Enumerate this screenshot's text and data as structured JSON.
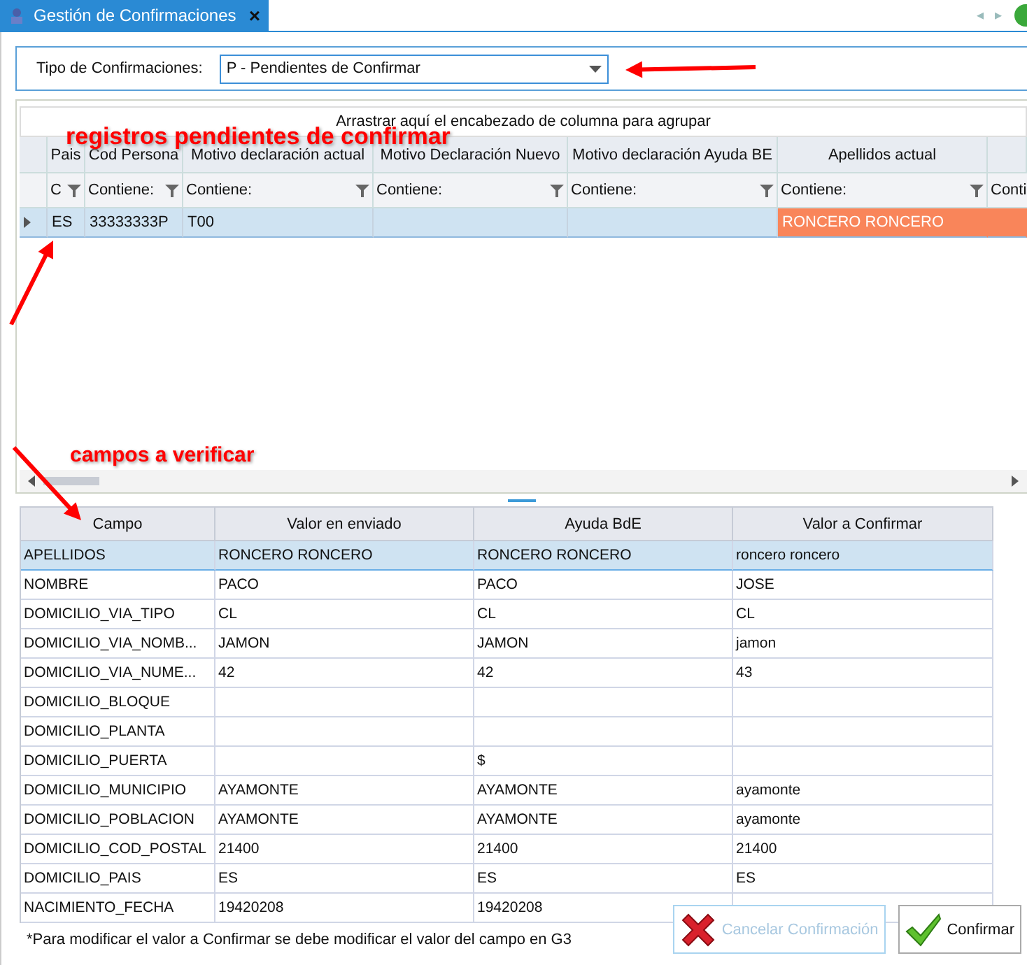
{
  "window": {
    "title": "Gestión de Confirmaciones",
    "close": "×",
    "nav_prev": "◂",
    "nav_next": "▸"
  },
  "filter": {
    "label": "Tipo de Confirmaciones:",
    "value": "P - Pendientes de Confirmar"
  },
  "records_grid": {
    "group_hint": "Arrastrar aquí el encabezado de columna para agrupar",
    "columns": [
      {
        "header": "Pais",
        "filter": "C"
      },
      {
        "header": "Cod Persona",
        "filter": "Contiene:"
      },
      {
        "header": "Motivo declaración actual",
        "filter": "Contiene:"
      },
      {
        "header": "Motivo Declaración Nuevo",
        "filter": "Contiene:"
      },
      {
        "header": "Motivo declaración Ayuda BE",
        "filter": "Contiene:"
      },
      {
        "header": "Apellidos actual",
        "filter": "Contiene:"
      },
      {
        "filter": "Conti"
      }
    ],
    "rows": [
      {
        "selected": true,
        "cells": [
          {
            "text": "ES",
            "highlighted": false
          },
          {
            "text": "33333333P",
            "highlighted": false
          },
          {
            "text": "T00",
            "highlighted": false
          },
          {
            "text": "",
            "highlighted": false
          },
          {
            "text": "",
            "highlighted": false
          },
          {
            "text": "RONCERO RONCERO",
            "highlighted": true
          },
          {
            "text": "",
            "highlighted": true
          }
        ]
      }
    ]
  },
  "fields_grid": {
    "columns": [
      "Campo",
      "Valor en enviado",
      "Ayuda BdE",
      "Valor a Confirmar"
    ],
    "rows": [
      {
        "selected": true,
        "cells": [
          "APELLIDOS",
          "RONCERO RONCERO",
          "RONCERO RONCERO",
          "roncero roncero"
        ]
      },
      {
        "selected": false,
        "cells": [
          "NOMBRE",
          "PACO",
          "PACO",
          "JOSE"
        ]
      },
      {
        "selected": false,
        "cells": [
          "DOMICILIO_VIA_TIPO",
          "CL",
          "CL",
          "CL"
        ]
      },
      {
        "selected": false,
        "cells": [
          "DOMICILIO_VIA_NOMB...",
          "JAMON",
          "JAMON",
          "jamon"
        ]
      },
      {
        "selected": false,
        "cells": [
          "DOMICILIO_VIA_NUME...",
          "42",
          "42",
          "43"
        ]
      },
      {
        "selected": false,
        "cells": [
          "DOMICILIO_BLOQUE",
          "",
          "",
          ""
        ]
      },
      {
        "selected": false,
        "cells": [
          "DOMICILIO_PLANTA",
          "",
          "",
          ""
        ]
      },
      {
        "selected": false,
        "cells": [
          "DOMICILIO_PUERTA",
          "",
          "$",
          ""
        ]
      },
      {
        "selected": false,
        "cells": [
          "DOMICILIO_MUNICIPIO",
          "AYAMONTE",
          "AYAMONTE",
          "ayamonte"
        ]
      },
      {
        "selected": false,
        "cells": [
          "DOMICILIO_POBLACION",
          "AYAMONTE",
          "AYAMONTE",
          "ayamonte"
        ]
      },
      {
        "selected": false,
        "cells": [
          "DOMICILIO_COD_POSTAL",
          "21400",
          "21400",
          "21400"
        ]
      },
      {
        "selected": false,
        "cells": [
          "DOMICILIO_PAIS",
          "ES",
          "ES",
          "ES"
        ]
      },
      {
        "selected": false,
        "cells": [
          "NACIMIENTO_FECHA",
          "19420208",
          "19420208",
          ""
        ]
      }
    ]
  },
  "note": "*Para modificar el valor a Confirmar se debe modificar el valor del campo en G3",
  "buttons": [
    {
      "kind": "cancel",
      "label": "Cancelar Confirmación",
      "disabled": true
    },
    {
      "kind": "confirm",
      "label": "Confirmar",
      "disabled": false
    }
  ],
  "annotations": [
    "registros pendientes de confirmar",
    "campos a verificar"
  ]
}
